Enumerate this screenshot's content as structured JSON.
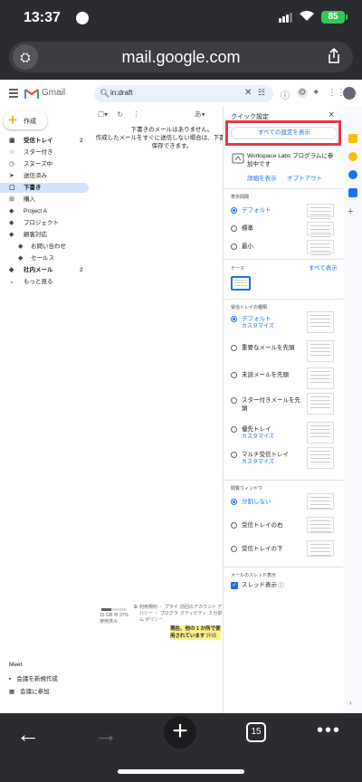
{
  "status": {
    "time": "13:37",
    "battery": "85"
  },
  "browser": {
    "url": "mail.google.com",
    "tab_count": "15"
  },
  "gmail": {
    "app_name": "Gmail",
    "search_query": "in:draft",
    "compose": "作成",
    "nav": [
      {
        "label": "受信トレイ",
        "count": "2",
        "icon": "inbox-icon",
        "glyph": "▣",
        "bold": true
      },
      {
        "label": "スター付き",
        "count": "",
        "icon": "star-icon",
        "glyph": "☆"
      },
      {
        "label": "スヌーズ中",
        "count": "",
        "icon": "clock-icon",
        "glyph": "◷"
      },
      {
        "label": "送信済み",
        "count": "",
        "icon": "send-icon",
        "glyph": "➤"
      },
      {
        "label": "下書き",
        "count": "",
        "icon": "draft-icon",
        "glyph": "▢",
        "active": true
      },
      {
        "label": "購入",
        "count": "",
        "icon": "cart-icon",
        "glyph": "⊞"
      },
      {
        "label": "Project A",
        "count": "",
        "icon": "label-icon",
        "glyph": "◆"
      },
      {
        "label": "プロジェクト",
        "count": "",
        "icon": "label-icon",
        "glyph": "◆"
      },
      {
        "label": "顧客対応",
        "count": "",
        "icon": "label-icon",
        "glyph": "◆"
      },
      {
        "label": "お問い合わせ",
        "count": "",
        "icon": "label-icon",
        "glyph": "◆",
        "indent": true
      },
      {
        "label": "セールス",
        "count": "",
        "icon": "label-icon",
        "glyph": "◆",
        "indent": true
      },
      {
        "label": "社内メール",
        "count": "2",
        "icon": "label-icon",
        "glyph": "◆",
        "bold": true
      },
      {
        "label": "もっと見る",
        "count": "",
        "icon": "chevron-down-icon",
        "glyph": "⌄"
      }
    ],
    "meet": {
      "title": "Meet",
      "new_meeting": "会議を新規作成",
      "join": "会議に参加"
    },
    "empty_line1": "下書きのメールはありません。",
    "empty_line2": "作成したメールをすぐに送信しない場合は、下書きとして保存できます。",
    "footer": {
      "storage": "15 GB 中 37% 使用済み",
      "terms": "利用規約 ・ プライバシー ・ プログラム ポリシー",
      "activity": "前回のアカウント アクティビティ: 3 分前",
      "details": "詳細",
      "tooltip": "現在、他の 1 か所で使用されています"
    },
    "quick_settings": {
      "title": "クイック設定",
      "all_settings": "すべての設定を表示",
      "workspace_labs": "Workspace Labs プログラムに参加中です",
      "details": "詳細を表示",
      "optout": "オプトアウト",
      "density_header": "表示間隔",
      "density": [
        "デフォルト",
        "標準",
        "最小"
      ],
      "theme_header": "テーマ",
      "theme_all": "すべて表示",
      "inbox_header": "受信トレイの種類",
      "inbox_types": [
        {
          "label": "デフォルト",
          "sub": "カスタマイズ"
        },
        {
          "label": "重要なメールを先頭",
          "sub": ""
        },
        {
          "label": "未読メールを先頭",
          "sub": ""
        },
        {
          "label": "スター付きメールを先頭",
          "sub": ""
        },
        {
          "label": "優先トレイ",
          "sub": "カスタマイズ"
        },
        {
          "label": "マルチ受信トレイ",
          "sub": "カスタマイズ"
        }
      ],
      "pane_header": "閲覧ウィンドウ",
      "pane": [
        "分割しない",
        "受信トレイの右",
        "受信トレイの下"
      ],
      "thread_header": "メールのスレッド表示",
      "thread": "スレッド表示"
    }
  }
}
